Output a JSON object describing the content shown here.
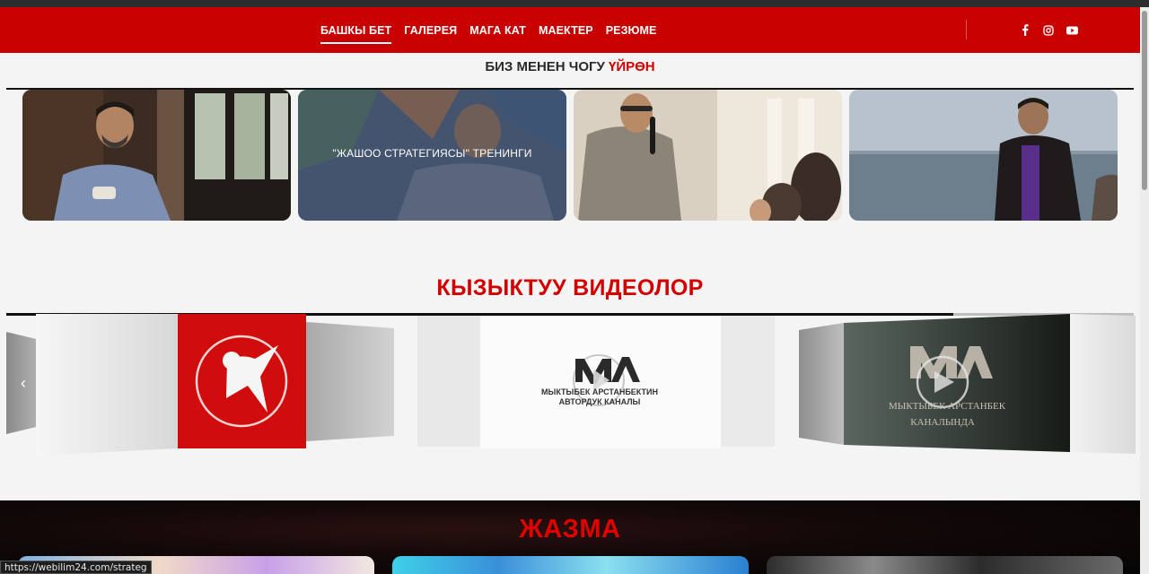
{
  "nav": {
    "items": [
      {
        "label": "БАШКЫ БЕТ",
        "active": true
      },
      {
        "label": "ГАЛЕРЕЯ"
      },
      {
        "label": "МАГА КАТ"
      },
      {
        "label": "МАЕКТЕР"
      },
      {
        "label": "РЕЗЮМЕ"
      }
    ],
    "social_icons": [
      "facebook-icon",
      "instagram-icon",
      "youtube-icon"
    ]
  },
  "learn_section": {
    "title_main": "БИЗ МЕНЕН ЧОГУ ",
    "title_accent": "ҮЙРӨН",
    "cards": [
      {
        "caption": ""
      },
      {
        "caption": "\"ЖАШОО СТРАТЕГИЯСЫ\" ТРЕНИНГИ"
      },
      {
        "caption": ""
      },
      {
        "caption": ""
      }
    ]
  },
  "videos_section": {
    "title": "КЫЗЫКТУУ ВИДЕОЛОР",
    "slides": [
      {
        "logo_text": ""
      },
      {
        "logo_line1": "МЫКТЫБЕК АРСТАНБЕКТИН",
        "logo_line2": "АВТОРДУК КАНАЛЫ"
      },
      {
        "logo_line1": "МЫКТЫБЕК АРСТАНБЕК",
        "logo_line2": "КАНАЛЫНДА"
      }
    ],
    "prev_arrow": "‹"
  },
  "blog_section": {
    "title": "ЖАЗМА"
  },
  "status_bar": {
    "url": "https://webilim24.com/strateg"
  },
  "colors": {
    "brand_red": "#c90000",
    "accent_red": "#d40000"
  }
}
